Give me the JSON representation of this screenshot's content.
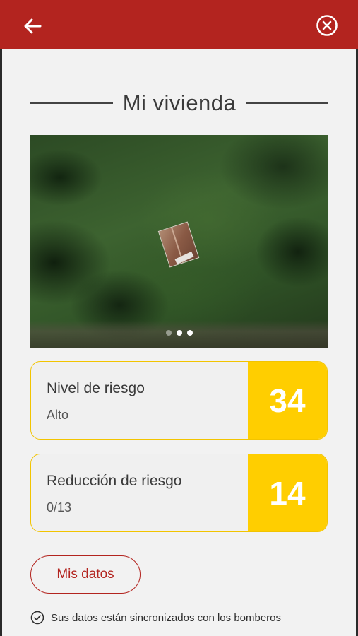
{
  "header": {
    "back_icon": "arrow-left-icon",
    "close_icon": "circle-x-icon",
    "bar_color": "#b3241f"
  },
  "title": "Mi vivienda",
  "photo": {
    "total_slides": 3,
    "active_slide": 3
  },
  "cards": [
    {
      "label": "Nivel de riesgo",
      "sub": "Alto",
      "value": "34"
    },
    {
      "label": "Reducción de riesgo",
      "sub": "0/13",
      "value": "14"
    }
  ],
  "accent_color": "#ffce00",
  "buttons": {
    "mis_datos": "Mis datos"
  },
  "sync": {
    "icon": "check-circle-icon",
    "text": "Sus datos están sincronizados con los bomberos"
  }
}
